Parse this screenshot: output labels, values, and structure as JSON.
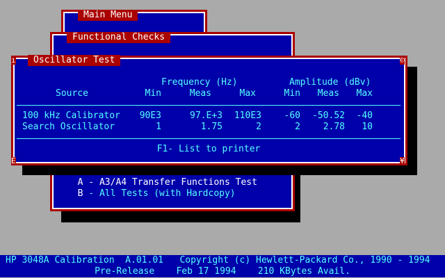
{
  "main_menu": {
    "title": "Main Menu"
  },
  "functional_checks": {
    "title": "Functional Checks",
    "items": [
      {
        "key": "A",
        "label": " - A3/A4 Transfer Functions Test"
      },
      {
        "key": "B",
        "label": " - All Tests (with Hardcopy)"
      }
    ]
  },
  "oscillator_test": {
    "title": "Oscillator Test",
    "group_headers": {
      "frequency": "Frequency (Hz)",
      "amplitude": "Amplitude (dBv)"
    },
    "columns": {
      "source": "Source",
      "min": "Min",
      "meas": "Meas",
      "max": "Max"
    },
    "rows": [
      {
        "source": "100 kHz Calibrator",
        "f_min": "90E3",
        "f_meas": "97.E+3",
        "f_max": "110E3",
        "a_min": "-60",
        "a_meas": "-50.52",
        "a_max": "-40"
      },
      {
        "source": "Search Oscillator",
        "f_min": "1",
        "f_meas": "1.75",
        "f_max": "2",
        "a_min": "2",
        "a_meas": "2.78",
        "a_max": "10"
      }
    ],
    "footer": "F1- List to printer"
  },
  "status_bar": {
    "line1": "HP 3048A Calibration  A.01.01   Copyright (c) Hewlett-Packard Co., 1990 - 1994",
    "line2": "Pre-Release    Feb 17 1994    210 KBytes Avail."
  }
}
